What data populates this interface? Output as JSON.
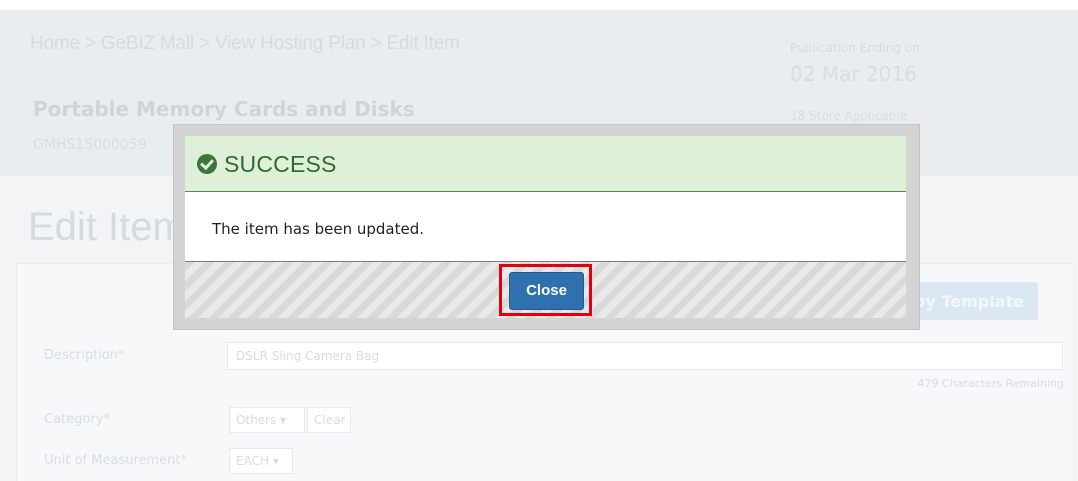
{
  "background": {
    "breadcrumb": "Home > GeBIZ Mall > View Hosting Plan > Edit Item",
    "publication_label": "Publication Ending on",
    "publication_date": "02 Mar 2016",
    "item_title": "Portable Memory Cards and Disks",
    "item_code": "GMHS15000059",
    "stores_label": "18 Store Applicable",
    "section_title": "Edit Item",
    "template_button_label": "py Template",
    "description_label": "Description",
    "description_value": "DSLR Sling Camera Bag",
    "char_remaining": "479 Characters Remaining",
    "category_label": "Category",
    "category_value": "Others ▾",
    "category_clear": "Clear",
    "uom_label": "Unit of Measurement",
    "uom_value": "EACH ▾",
    "required_marker": "*"
  },
  "modal": {
    "title": "SUCCESS",
    "message": "The item has been updated.",
    "close_label": "Close",
    "icon": "check-circle-icon"
  },
  "colors": {
    "success_bg": "#dff0d8",
    "success_text": "#2f6b2f",
    "primary_button": "#2f70ae",
    "highlight": "#e0000f"
  }
}
